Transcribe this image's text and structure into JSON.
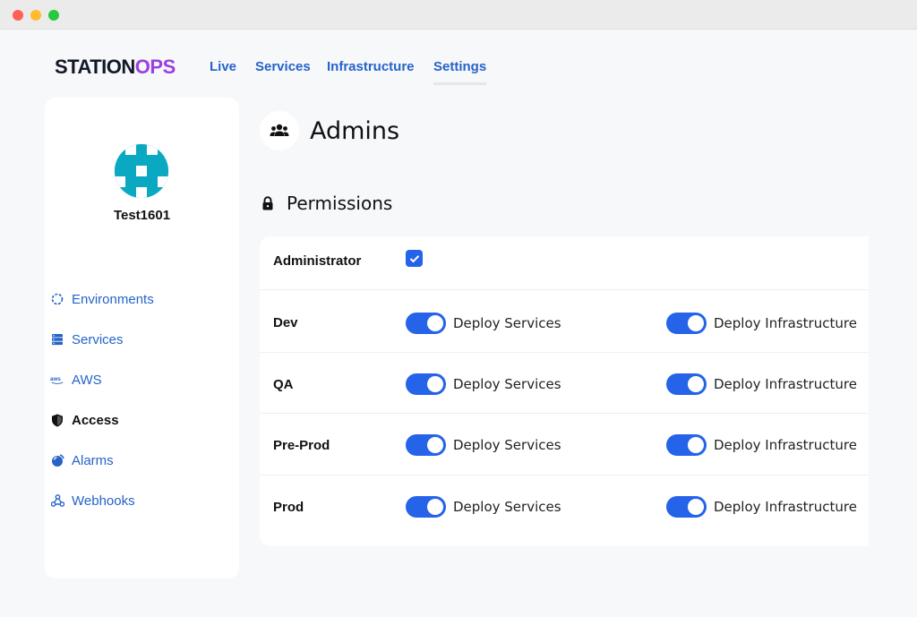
{
  "brand": {
    "part1": "STATION",
    "part2": "OPS"
  },
  "nav": [
    {
      "label": "Live"
    },
    {
      "label": "Services"
    },
    {
      "label": "Infrastructure"
    },
    {
      "label": "Settings"
    }
  ],
  "sidebar": {
    "username": "Test1601",
    "items": [
      {
        "label": "Environments",
        "icon": "environments-icon"
      },
      {
        "label": "Services",
        "icon": "server-icon"
      },
      {
        "label": "AWS",
        "icon": "aws-icon"
      },
      {
        "label": "Access",
        "icon": "shield-icon"
      },
      {
        "label": "Alarms",
        "icon": "alarm-icon"
      },
      {
        "label": "Webhooks",
        "icon": "webhooks-icon"
      }
    ]
  },
  "main": {
    "title": "Admins",
    "permissions_title": "Permissions",
    "administrator": {
      "label": "Administrator",
      "checked": true
    },
    "environments": [
      {
        "name": "Dev",
        "deploy_services": "Deploy Services",
        "deploy_infrastructure": "Deploy Infrastructure",
        "services_on": true,
        "infra_on": true
      },
      {
        "name": "QA",
        "deploy_services": "Deploy Services",
        "deploy_infrastructure": "Deploy Infrastructure",
        "services_on": true,
        "infra_on": true
      },
      {
        "name": "Pre-Prod",
        "deploy_services": "Deploy Services",
        "deploy_infrastructure": "Deploy Infrastructure",
        "services_on": true,
        "infra_on": true
      },
      {
        "name": "Prod",
        "deploy_services": "Deploy Services",
        "deploy_infrastructure": "Deploy Infrastructure",
        "services_on": true,
        "infra_on": true
      }
    ]
  },
  "colors": {
    "accent": "#2563e9",
    "link": "#2563c9",
    "brand_purple": "#9b3fe0",
    "avatar": "#0aa8c1"
  }
}
